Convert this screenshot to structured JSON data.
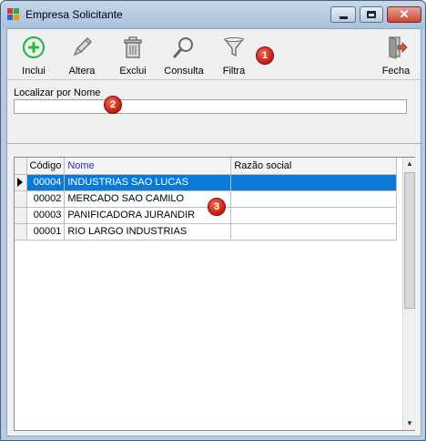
{
  "window": {
    "title": "Empresa Solicitante",
    "close_glyph": "✕",
    "icon": "app-grid-icon"
  },
  "toolbar": {
    "buttons": [
      {
        "label": "Inclui",
        "icon": "add-circle-icon"
      },
      {
        "label": "Altera",
        "icon": "pencil-icon"
      },
      {
        "label": "Exclui",
        "icon": "trash-icon"
      },
      {
        "label": "Consulta",
        "icon": "magnifier-icon"
      },
      {
        "label": "Filtra",
        "icon": "funnel-icon"
      },
      {
        "label": "Fecha",
        "icon": "exit-door-icon"
      }
    ]
  },
  "markers": [
    "1",
    "2",
    "3"
  ],
  "search": {
    "label": "Localizar por Nome",
    "value": ""
  },
  "grid": {
    "columns": [
      "Código",
      "Nome",
      "Razão social"
    ],
    "sorted_column": "Nome",
    "rows": [
      {
        "code": "00004",
        "name": "INDUSTRIAS SAO LUCAS",
        "razao": ""
      },
      {
        "code": "00002",
        "name": "MERCADO SAO CAMILO",
        "razao": ""
      },
      {
        "code": "00003",
        "name": "PANIFICADORA JURANDIR",
        "razao": ""
      },
      {
        "code": "00001",
        "name": "RIO LARGO INDUSTRIAS",
        "razao": ""
      }
    ],
    "selected_row": 0
  },
  "colors": {
    "selection": "#0a7ad9",
    "sorted_header": "#1d2fc0",
    "marker": "#c21a0f",
    "add_icon": "#33b24a"
  }
}
